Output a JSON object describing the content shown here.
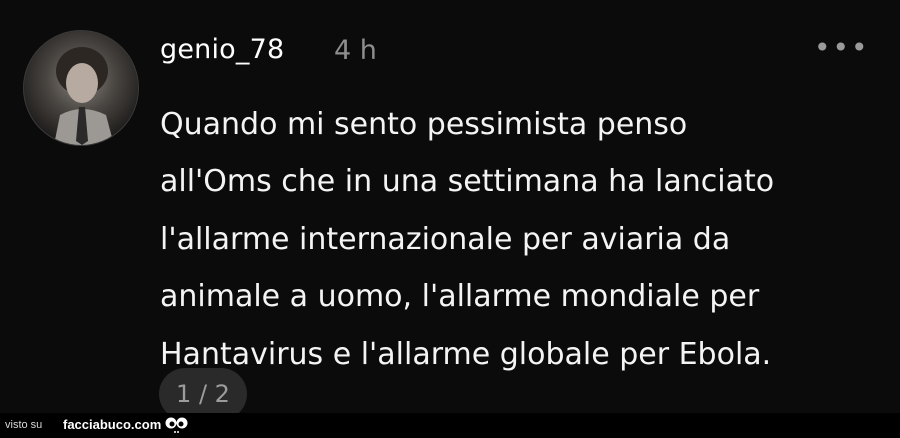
{
  "post": {
    "username": "genio_78",
    "time": "4 h",
    "more_icon": "ellipsis-icon",
    "lines": [
      "Quando mi sento pessimista penso",
      "all'Oms che in una settimana ha lanciato",
      "l'allarme internazionale per aviaria da",
      "animale a uomo, l'allarme mondiale per",
      "Hantavirus e l'allarme globale per Ebola."
    ],
    "pager": "1 / 2"
  },
  "footer": {
    "visto_su": "visto su",
    "site": "facciabuco.com"
  }
}
